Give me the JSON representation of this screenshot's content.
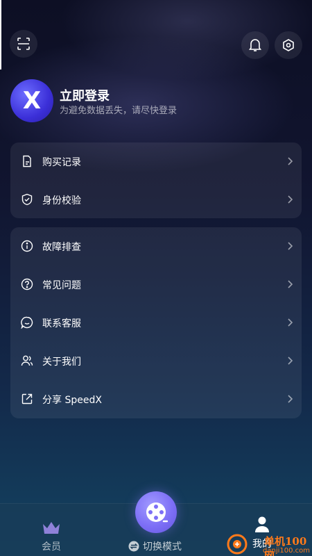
{
  "header": {
    "scan_icon": "scan-icon",
    "bell_icon": "bell-icon",
    "settings_icon": "settings-hex-icon"
  },
  "profile": {
    "avatar_letter": "X",
    "title": "立即登录",
    "subtitle": "为避免数据丢失，请尽快登录"
  },
  "menu_group1": [
    {
      "label": "购买记录",
      "icon": "document-icon"
    },
    {
      "label": "身份校验",
      "icon": "shield-check-icon"
    }
  ],
  "menu_group2": [
    {
      "label": "故障排查",
      "icon": "info-icon"
    },
    {
      "label": "常见问题",
      "icon": "question-icon"
    },
    {
      "label": "联系客服",
      "icon": "chat-icon"
    },
    {
      "label": "关于我们",
      "icon": "users-icon"
    },
    {
      "label": "分享 SpeedX",
      "icon": "share-icon"
    }
  ],
  "bottom_nav": {
    "vip_label": "会员",
    "switch_label": "切换模式",
    "me_label": "我的"
  },
  "watermark": {
    "line1": "单机100网",
    "line2": "danji100.com"
  },
  "colors": {
    "accent": "#7d6ff6",
    "avatar": "#3b2fd8",
    "vip_crown": "#a48df0"
  }
}
